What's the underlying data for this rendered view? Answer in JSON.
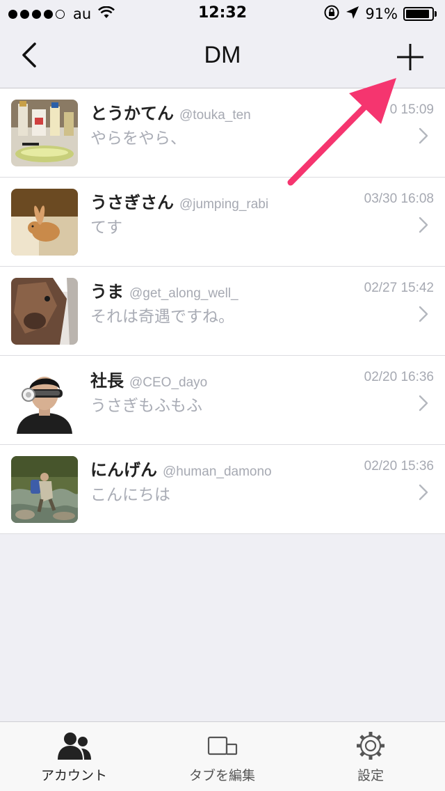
{
  "status_bar": {
    "carrier": "au",
    "time": "12:32",
    "battery_percent": "91%",
    "battery_level": 0.91,
    "signal_bars_filled": 4,
    "signal_bars_total": 5
  },
  "nav": {
    "title": "DM",
    "back_icon": "chevron-left-icon",
    "add_icon": "plus-icon"
  },
  "conversations": [
    {
      "name": "とうかてん",
      "handle": "@touka_ten",
      "time": "0 15:09",
      "preview": "やらをやら、",
      "avatar": "bottles-photo"
    },
    {
      "name": "うさぎさん",
      "handle": "@jumping_rabi",
      "time": "03/30 16:08",
      "preview": "てす",
      "avatar": "rabbit-photo"
    },
    {
      "name": "うま",
      "handle": "@get_along_well_",
      "time": "02/27 15:42",
      "preview": "それは奇遇ですね。",
      "avatar": "alpaca-photo"
    },
    {
      "name": "社長",
      "handle": "@CEO_dayo",
      "time": "02/20 16:36",
      "preview": "うさぎもふもふ",
      "avatar": "headset-person-photo"
    },
    {
      "name": "にんげん",
      "handle": "@human_damono",
      "time": "02/20 15:36",
      "preview": "こんにちは",
      "avatar": "hiker-river-photo"
    }
  ],
  "tabs": [
    {
      "label": "アカウント",
      "icon": "people-icon",
      "active": true
    },
    {
      "label": "タブを編集",
      "icon": "tabs-edit-icon",
      "active": false
    },
    {
      "label": "設定",
      "icon": "gear-icon",
      "active": false
    }
  ],
  "colors": {
    "background": "#efeff4",
    "annotation_arrow": "#f5356f",
    "secondary_text": "#a6a9b2"
  }
}
